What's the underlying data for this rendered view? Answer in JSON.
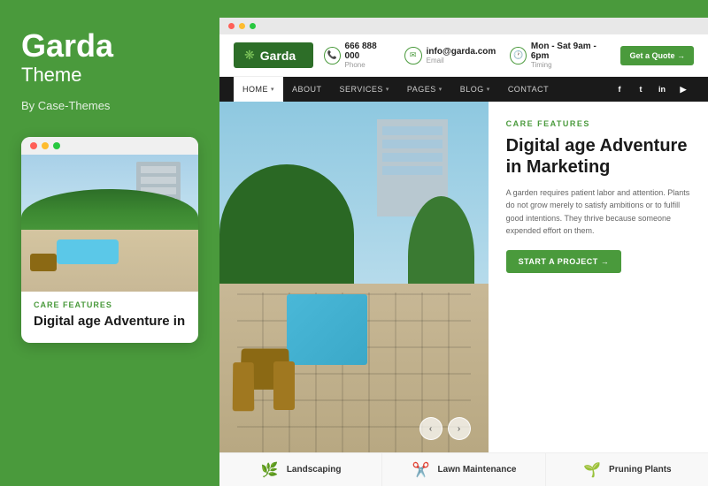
{
  "sidebar": {
    "brand_name": "Garda",
    "theme_label": "Theme",
    "by_label": "By Case-Themes",
    "dots": [
      "dot1",
      "dot2",
      "dot3"
    ],
    "preview": {
      "tag": "Care Features",
      "title": "Digital age Adventure in"
    }
  },
  "website": {
    "logo_text": "Garda",
    "header": {
      "phone_number": "666 888 000",
      "phone_label": "Phone",
      "email_address": "info@garda.com",
      "email_label": "Email",
      "timing": "Mon - Sat 9am - 6pm",
      "timing_label": "Timing",
      "cta_label": "Get a Quote →"
    },
    "nav": {
      "items": [
        {
          "label": "HOME",
          "has_chevron": true,
          "active": true
        },
        {
          "label": "ABOUT",
          "has_chevron": false,
          "active": false
        },
        {
          "label": "SERVICES",
          "has_chevron": true,
          "active": false
        },
        {
          "label": "PAGES",
          "has_chevron": true,
          "active": false
        },
        {
          "label": "BLOG",
          "has_chevron": true,
          "active": false
        },
        {
          "label": "CONTACT",
          "has_chevron": false,
          "active": false
        }
      ],
      "social": [
        "f",
        "t",
        "in",
        "▶"
      ]
    },
    "hero": {
      "tag": "Care Features",
      "title": "Digital age Adventure in Marketing",
      "description": "A garden requires patient labor and attention. Plants do not grow merely to satisfy ambitions or to fulfill good intentions. They thrive because someone expended effort on them.",
      "cta_label": "START A PROJECT →"
    },
    "services": [
      {
        "label": "Landscaping",
        "icon": "🌿"
      },
      {
        "label": "Lawn Maintenance",
        "icon": "✂️"
      },
      {
        "label": "Pruning Plants",
        "icon": "🌱"
      }
    ]
  },
  "browser": {
    "dots": [
      "#ff5f57",
      "#febc2e",
      "#28c840"
    ]
  }
}
